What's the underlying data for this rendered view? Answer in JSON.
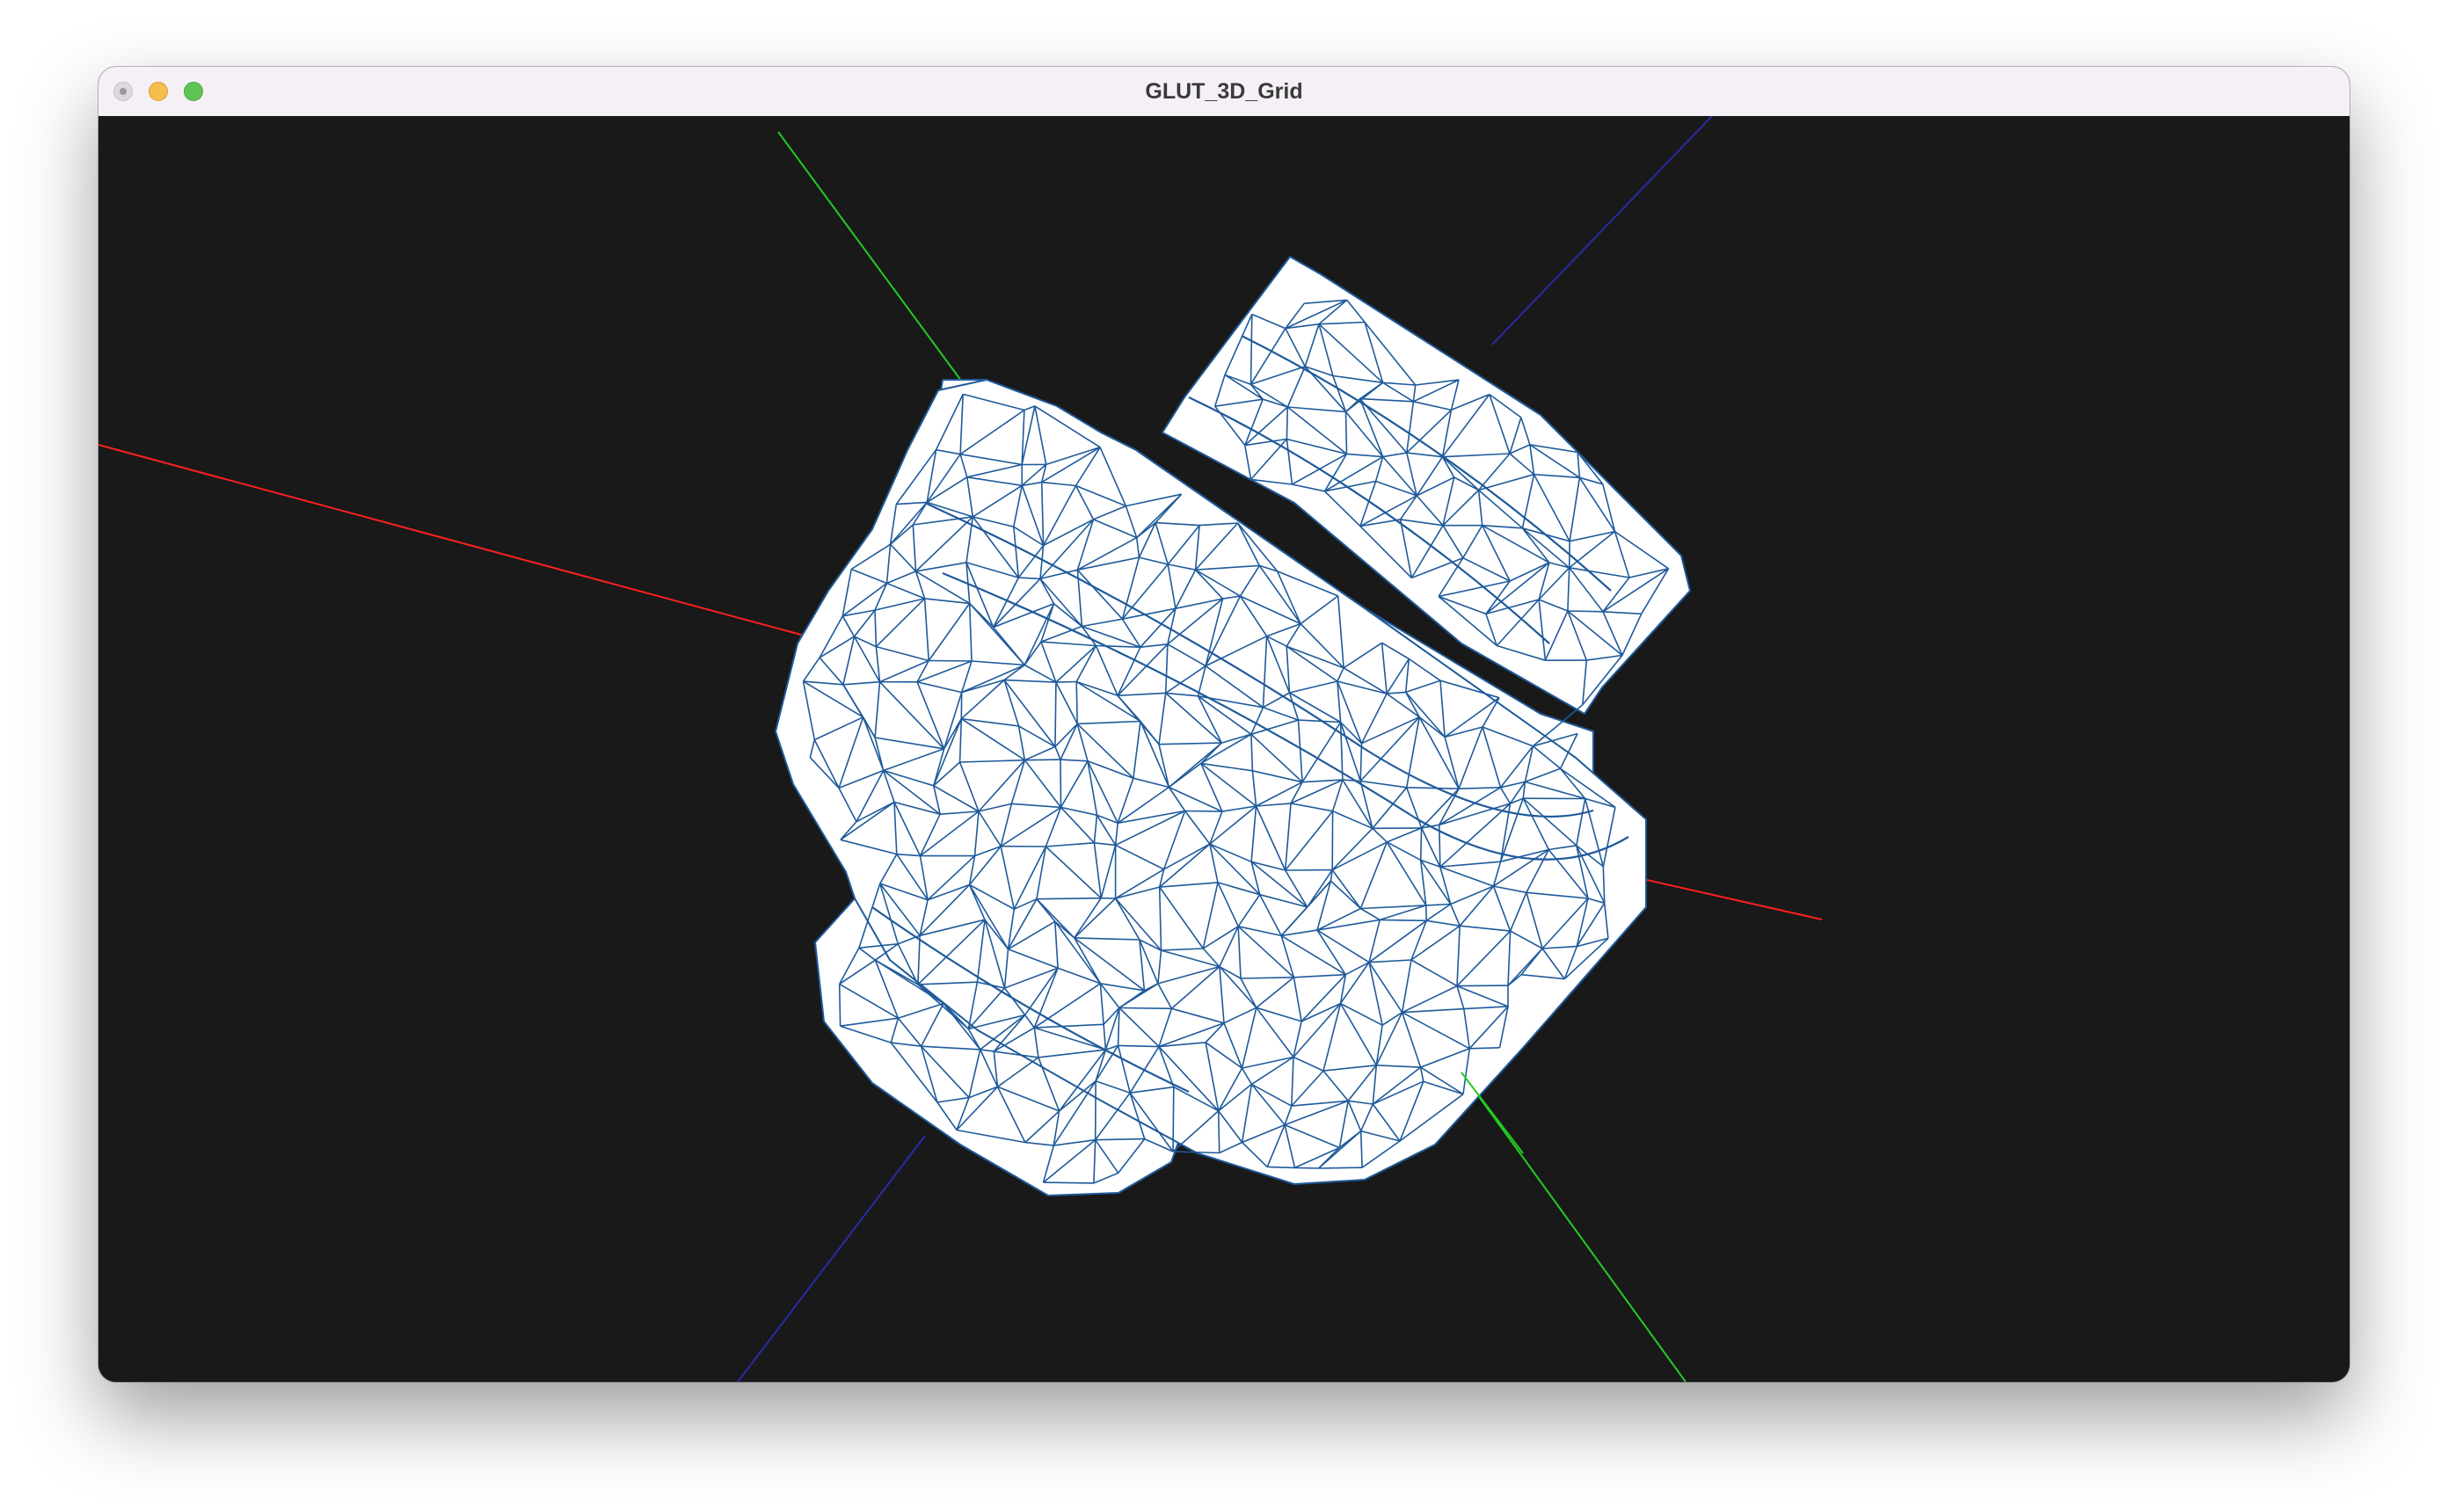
{
  "window": {
    "title": "GLUT_3D_Grid"
  },
  "colors": {
    "background": "#191919",
    "mesh_fill": "#ffffff",
    "mesh_wire": "#1f5a9a",
    "axis_x": "#ff2020",
    "axis_y": "#22cc22",
    "axis_z": "#2a2aa8",
    "titlebar": "#f5f0f6"
  },
  "icons": {
    "close": "close-icon",
    "minimize": "minimize-icon",
    "zoom": "zoom-icon"
  }
}
